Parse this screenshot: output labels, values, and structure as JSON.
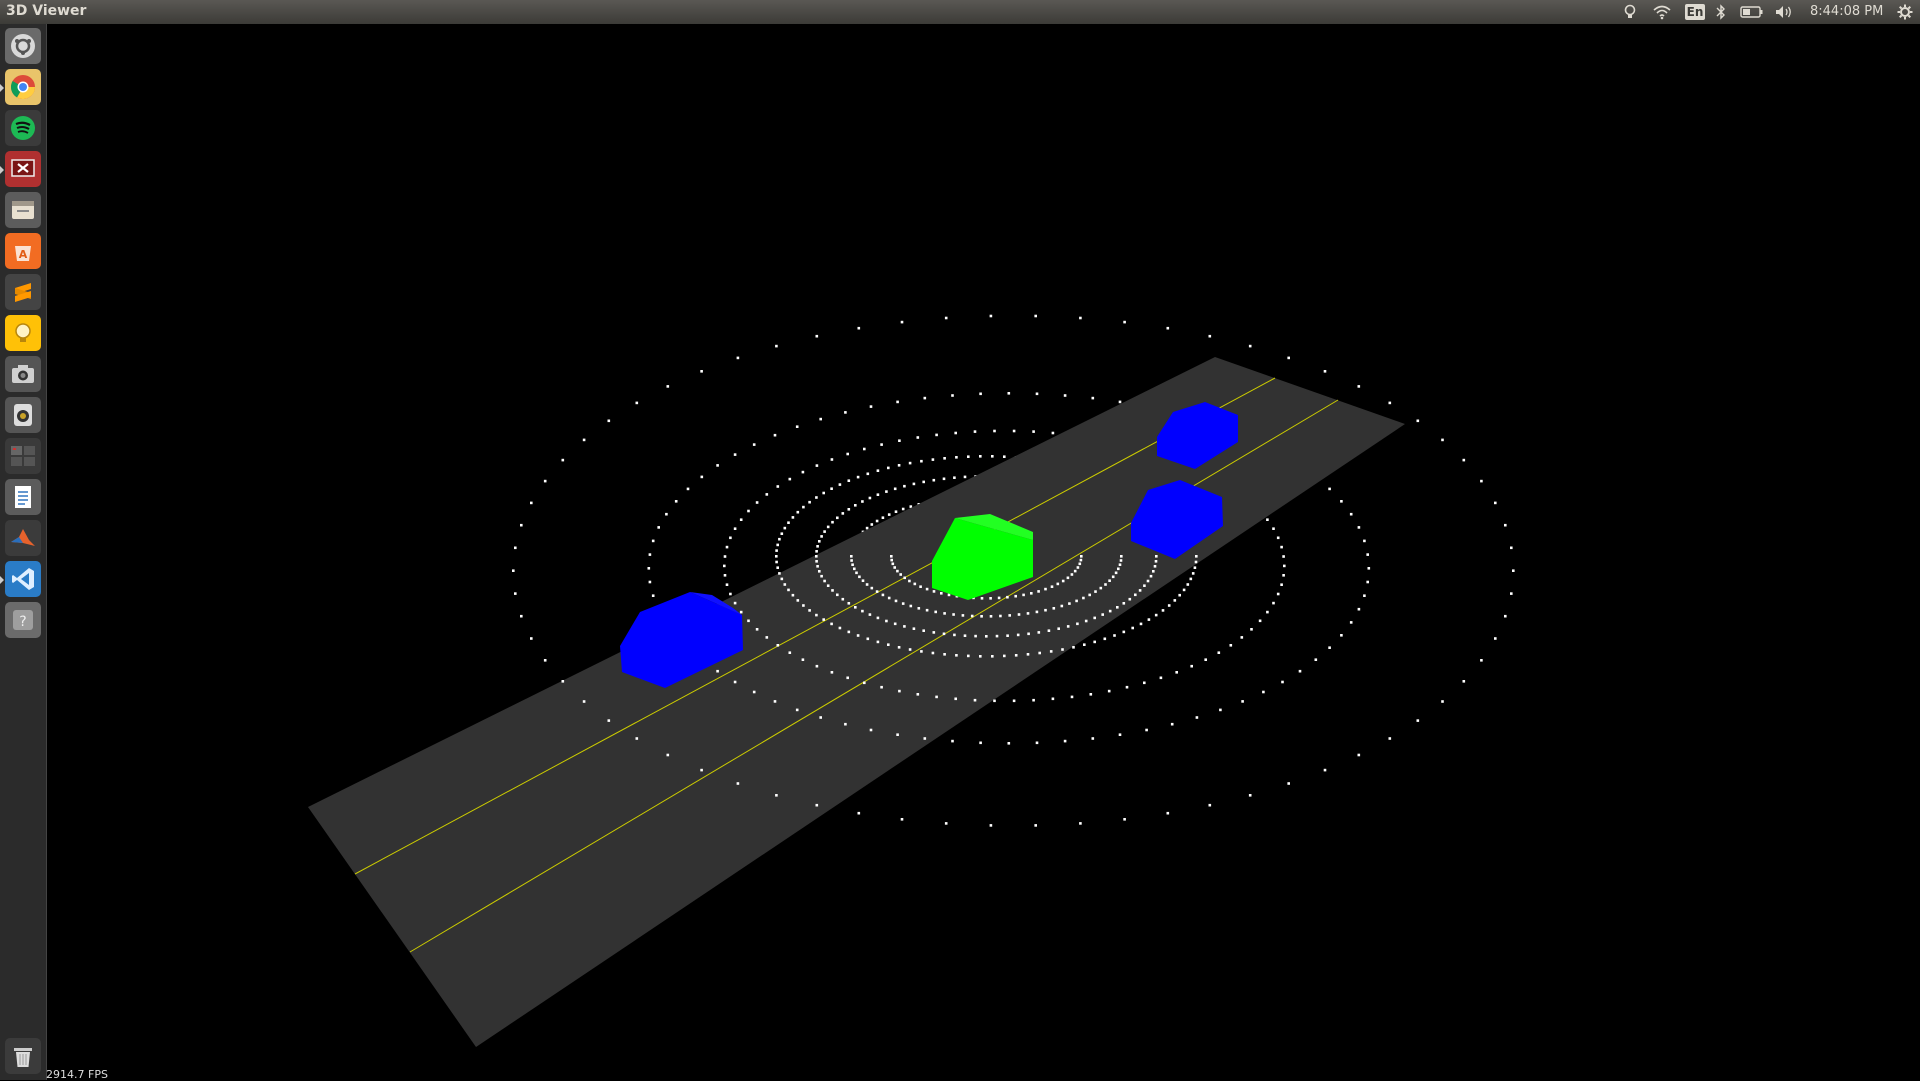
{
  "window": {
    "title": "3D Viewer"
  },
  "panel": {
    "indicators": [
      "lightbulb-icon",
      "wifi-icon",
      "keyboard-layout",
      "bluetooth-icon",
      "battery-icon",
      "volume-icon"
    ],
    "keyboard_layout": "En",
    "clock": "8:44:08 PM",
    "settings_icon": "gear-icon"
  },
  "launcher": {
    "items": [
      {
        "name": "dash-icon",
        "color": "#e0e0e0"
      },
      {
        "name": "chrome-icon",
        "color": "#dd4b39"
      },
      {
        "name": "spotify-icon",
        "color": "#1db954"
      },
      {
        "name": "presentation-app-icon",
        "color": "#c0392b"
      },
      {
        "name": "files-icon",
        "color": "#e8e0d0"
      },
      {
        "name": "software-center-icon",
        "color": "#f26c22"
      },
      {
        "name": "sublime-text-icon",
        "color": "#ff9800"
      },
      {
        "name": "ideas-bulb-icon",
        "color": "#ffc107"
      },
      {
        "name": "camera-icon",
        "color": "#bdbdbd"
      },
      {
        "name": "speaker-app-icon",
        "color": "#ddd"
      },
      {
        "name": "workspace-switcher-icon",
        "color": "#666"
      },
      {
        "name": "text-document-icon",
        "color": "#3f7fc4"
      },
      {
        "name": "matlab-icon",
        "color": "#e6622c"
      },
      {
        "name": "vscode-icon",
        "color": "#2a7cc7"
      },
      {
        "name": "unknown-app-icon",
        "color": "#9e9e9e"
      }
    ],
    "trash": "trash-icon"
  },
  "scene": {
    "background": "#000000",
    "road_color": "#323232",
    "lane_line_color": "#cccc00",
    "ego_vehicle_color": "#00ff00",
    "other_vehicle_color": "#0000ff",
    "point_color": "#ffffff",
    "other_vehicle_count": 3,
    "lidar_ring_count": 8
  },
  "status": {
    "fps": "2914.7 FPS"
  }
}
